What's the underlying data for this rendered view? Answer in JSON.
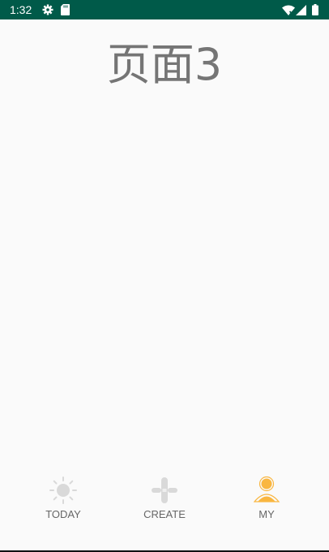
{
  "status_bar": {
    "time": "1:32",
    "icons": [
      "settings-icon",
      "sd-card-icon",
      "wifi-icon",
      "signal-icon",
      "battery-icon"
    ],
    "background": "#005a49"
  },
  "page": {
    "title": "页面3"
  },
  "bottom_nav": {
    "items": [
      {
        "label": "TODAY",
        "icon": "sun-icon",
        "selected": false
      },
      {
        "label": "CREATE",
        "icon": "create-icon",
        "selected": false
      },
      {
        "label": "MY",
        "icon": "person-icon",
        "selected": true
      }
    ],
    "active_color": "#f9b640",
    "inactive_color": "#d9d9d9"
  }
}
